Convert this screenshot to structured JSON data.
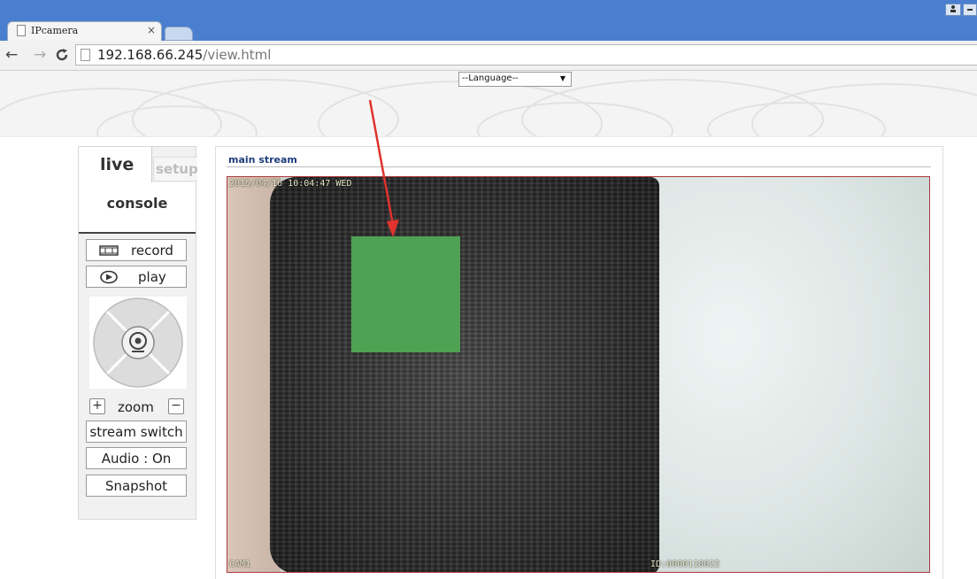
{
  "browser": {
    "tab_title": "IPcamera",
    "tab_close": "×",
    "url_host": "192.168.66.245",
    "url_path": "/view.html"
  },
  "language_select": {
    "selected": "--Language--"
  },
  "console": {
    "tab_live": "live",
    "tab_setup": "setup",
    "title": "console",
    "record_label": "record",
    "play_label": "play",
    "zoom_label": "zoom",
    "stream_switch_label": "stream switch",
    "audio_label": "Audio : On",
    "snapshot_label": "Snapshot"
  },
  "stream": {
    "title": "main stream",
    "osd_timestamp": "2015/04/16 10:04:47 WED",
    "osd_channel": "CAM1",
    "osd_id": "ID:0000118022"
  },
  "colors": {
    "annotation_arrow": "#e0332e",
    "green_block": "#4fa153",
    "browser_frame": "#4a7fd0"
  }
}
